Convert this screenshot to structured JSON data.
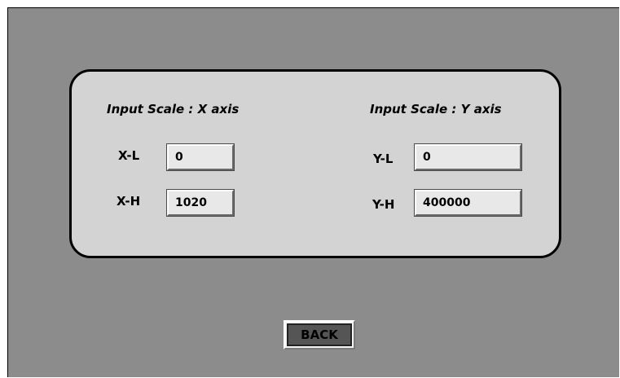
{
  "panel": {
    "x_heading": "Input Scale : X axis",
    "y_heading": "Input Scale : Y axis",
    "xl_label": "X-L",
    "xl_value": "0",
    "xh_label": "X-H",
    "xh_value": "1020",
    "yl_label": "Y-L",
    "yl_value": "0",
    "yh_label": "Y-H",
    "yh_value": "400000"
  },
  "footer": {
    "back_label": "BACK"
  },
  "colors": {
    "background": "#8c8c8c",
    "panel": "#d3d3d3",
    "field": "#e8e8e8",
    "button_face": "#555555"
  }
}
